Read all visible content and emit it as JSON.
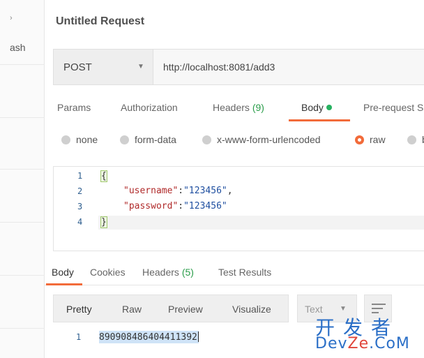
{
  "sidebar": {
    "partial_label": "ash"
  },
  "request": {
    "title": "Untitled Request",
    "method": "POST",
    "url": "http://localhost:8081/add3"
  },
  "request_tabs": {
    "params": "Params",
    "authorization": "Authorization",
    "headers_label": "Headers",
    "headers_count": "(9)",
    "body": "Body",
    "prerequest": "Pre-request S"
  },
  "body_modes": {
    "none": "none",
    "form_data": "form-data",
    "urlencoded": "x-www-form-urlencoded",
    "raw": "raw",
    "binary_partial": "b",
    "selected": "raw"
  },
  "editor": {
    "lines": [
      {
        "num": "1",
        "text": "{"
      },
      {
        "num": "2",
        "key": "\"username\"",
        "sep": ":",
        "value": "\"123456\"",
        "tail": ","
      },
      {
        "num": "3",
        "key": "\"password\"",
        "sep": ":",
        "value": "\"123456\"",
        "tail": ""
      },
      {
        "num": "4",
        "text": "}"
      }
    ]
  },
  "response_tabs": {
    "body": "Body",
    "cookies": "Cookies",
    "headers_label": "Headers",
    "headers_count": "(5)",
    "test_results": "Test Results"
  },
  "response_view": {
    "pretty": "Pretty",
    "raw": "Raw",
    "preview": "Preview",
    "visualize": "Visualize",
    "format": "Text"
  },
  "response": {
    "line_num": "1",
    "value": "890908486404411392"
  },
  "watermark": {
    "cn": "开发者",
    "en_a": "Dev",
    "en_b": "Ze",
    "en_c": ".CoM"
  },
  "colors": {
    "accent": "#f26b3a",
    "status_green": "#26b160",
    "link_blue": "#2b6fc7"
  }
}
